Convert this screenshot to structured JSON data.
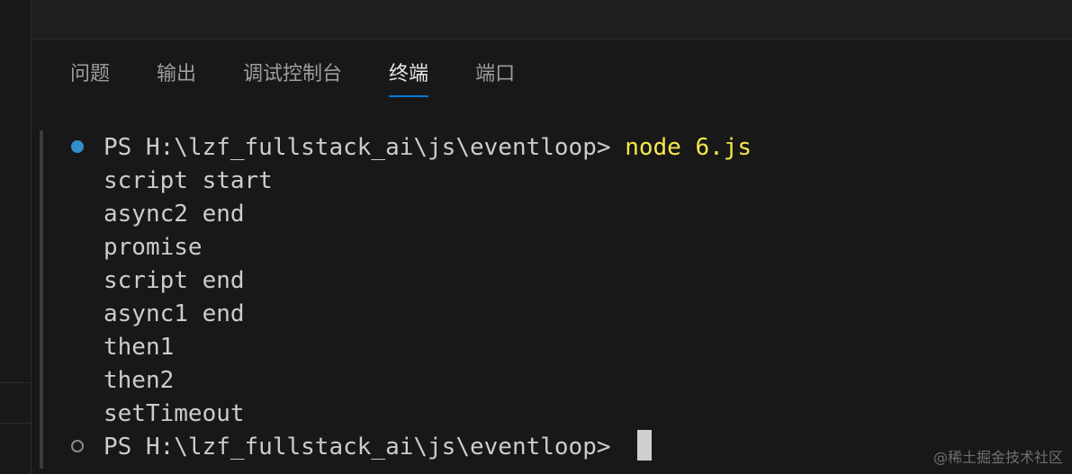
{
  "panel": {
    "tabs": [
      {
        "label": "问题",
        "active": false
      },
      {
        "label": "输出",
        "active": false
      },
      {
        "label": "调试控制台",
        "active": false
      },
      {
        "label": "终端",
        "active": true
      },
      {
        "label": "端口",
        "active": false
      }
    ]
  },
  "terminal": {
    "prompt": "PS H:\\lzf_fullstack_ai\\js\\eventloop> ",
    "command": "node 6.js",
    "output": [
      "script start",
      "async2 end",
      "promise",
      "script end",
      "async1 end",
      "then1",
      "then2",
      "setTimeout"
    ],
    "final_prompt": "PS H:\\lzf_fullstack_ai\\js\\eventloop> "
  },
  "watermark": "@稀土掘金技术社区",
  "colors": {
    "background": "#181818",
    "accent": "#0078d4",
    "command": "#f6e84a",
    "success_dot": "#2f8fc7"
  }
}
